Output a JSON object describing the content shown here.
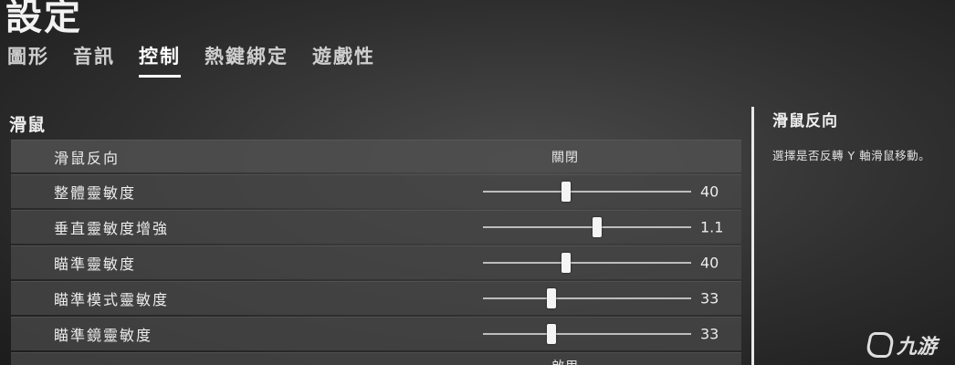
{
  "header": {
    "title": "設定"
  },
  "tabs": [
    {
      "label": "圖形",
      "active": false
    },
    {
      "label": "音訊",
      "active": false
    },
    {
      "label": "控制",
      "active": true
    },
    {
      "label": "熱鍵綁定",
      "active": false
    },
    {
      "label": "遊戲性",
      "active": false
    }
  ],
  "section": {
    "title": "滑鼠"
  },
  "settings": {
    "invert_mouse": {
      "label": "滑鼠反向",
      "value": "關閉"
    },
    "overall_sensitivity": {
      "label": "整體靈敏度",
      "value": "40",
      "level": 0.4
    },
    "vertical_sensitivity_boost": {
      "label": "垂直靈敏度增強",
      "value": "1.1",
      "level": 0.55
    },
    "aim_sensitivity": {
      "label": "瞄準靈敏度",
      "value": "40",
      "level": 0.4
    },
    "aim_mode_sensitivity": {
      "label": "瞄準模式靈敏度",
      "value": "33",
      "level": 0.33
    },
    "scope_sensitivity": {
      "label": "瞄準鏡靈敏度",
      "value": "33",
      "level": 0.33
    },
    "next_option": {
      "value": "啟用"
    }
  },
  "description": {
    "title": "滑鼠反向",
    "text": "選擇是否反轉 Y 軸滑鼠移動。"
  },
  "watermark": {
    "text": "九游"
  },
  "colors": {
    "background": "#3a3a3a",
    "row": "#464646",
    "accent": "#ffffff"
  }
}
